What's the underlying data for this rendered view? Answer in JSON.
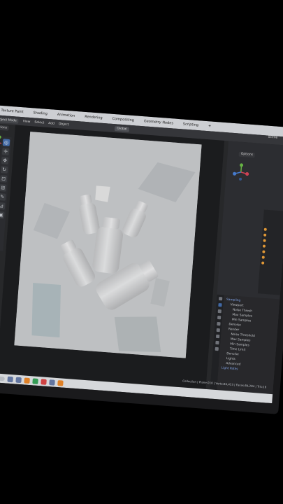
{
  "workspace_tabs": [
    "Texture Paint",
    "Shading",
    "Animation",
    "Rendering",
    "Compositing",
    "Geometry Nodes",
    "Scripting",
    "+"
  ],
  "header": {
    "options_label": "Options",
    "mode_label": "Object Mode",
    "menu_items": [
      "View",
      "Select",
      "Add",
      "Object"
    ],
    "transform_orientation": "Global",
    "scene_label": "Scene"
  },
  "right_panel": {
    "options_label": "Options"
  },
  "properties": {
    "rows": [
      {
        "text": "Sampling",
        "level": 0
      },
      {
        "text": "Viewport",
        "level": 1
      },
      {
        "text": "Noise Thresh",
        "level": 2
      },
      {
        "text": "Max Samples",
        "level": 2
      },
      {
        "text": "Min Samples",
        "level": 2
      },
      {
        "text": "Denoise",
        "level": 1
      },
      {
        "text": "Render",
        "level": 1
      },
      {
        "text": "Noise Threshold",
        "level": 2
      },
      {
        "text": "Max Samples",
        "level": 2
      },
      {
        "text": "Min Samples",
        "level": 2
      },
      {
        "text": "Time Limit",
        "level": 2
      },
      {
        "text": "Denoise",
        "level": 1
      },
      {
        "text": "Lights",
        "level": 1
      },
      {
        "text": "Advanced",
        "level": 1
      },
      {
        "text": "Light Paths",
        "level": 0
      }
    ]
  },
  "status_bar": {
    "text": "Collection | Plane.010 | Verts:84,423 | Faces:84,284 | Tris:16"
  },
  "colors": {
    "render_background": "#cfd1d3",
    "bottle": "#e3e4e6",
    "card_blue": "#b5c3c7",
    "card_grey": "#bfc3c6",
    "accent": "#4772b3"
  }
}
